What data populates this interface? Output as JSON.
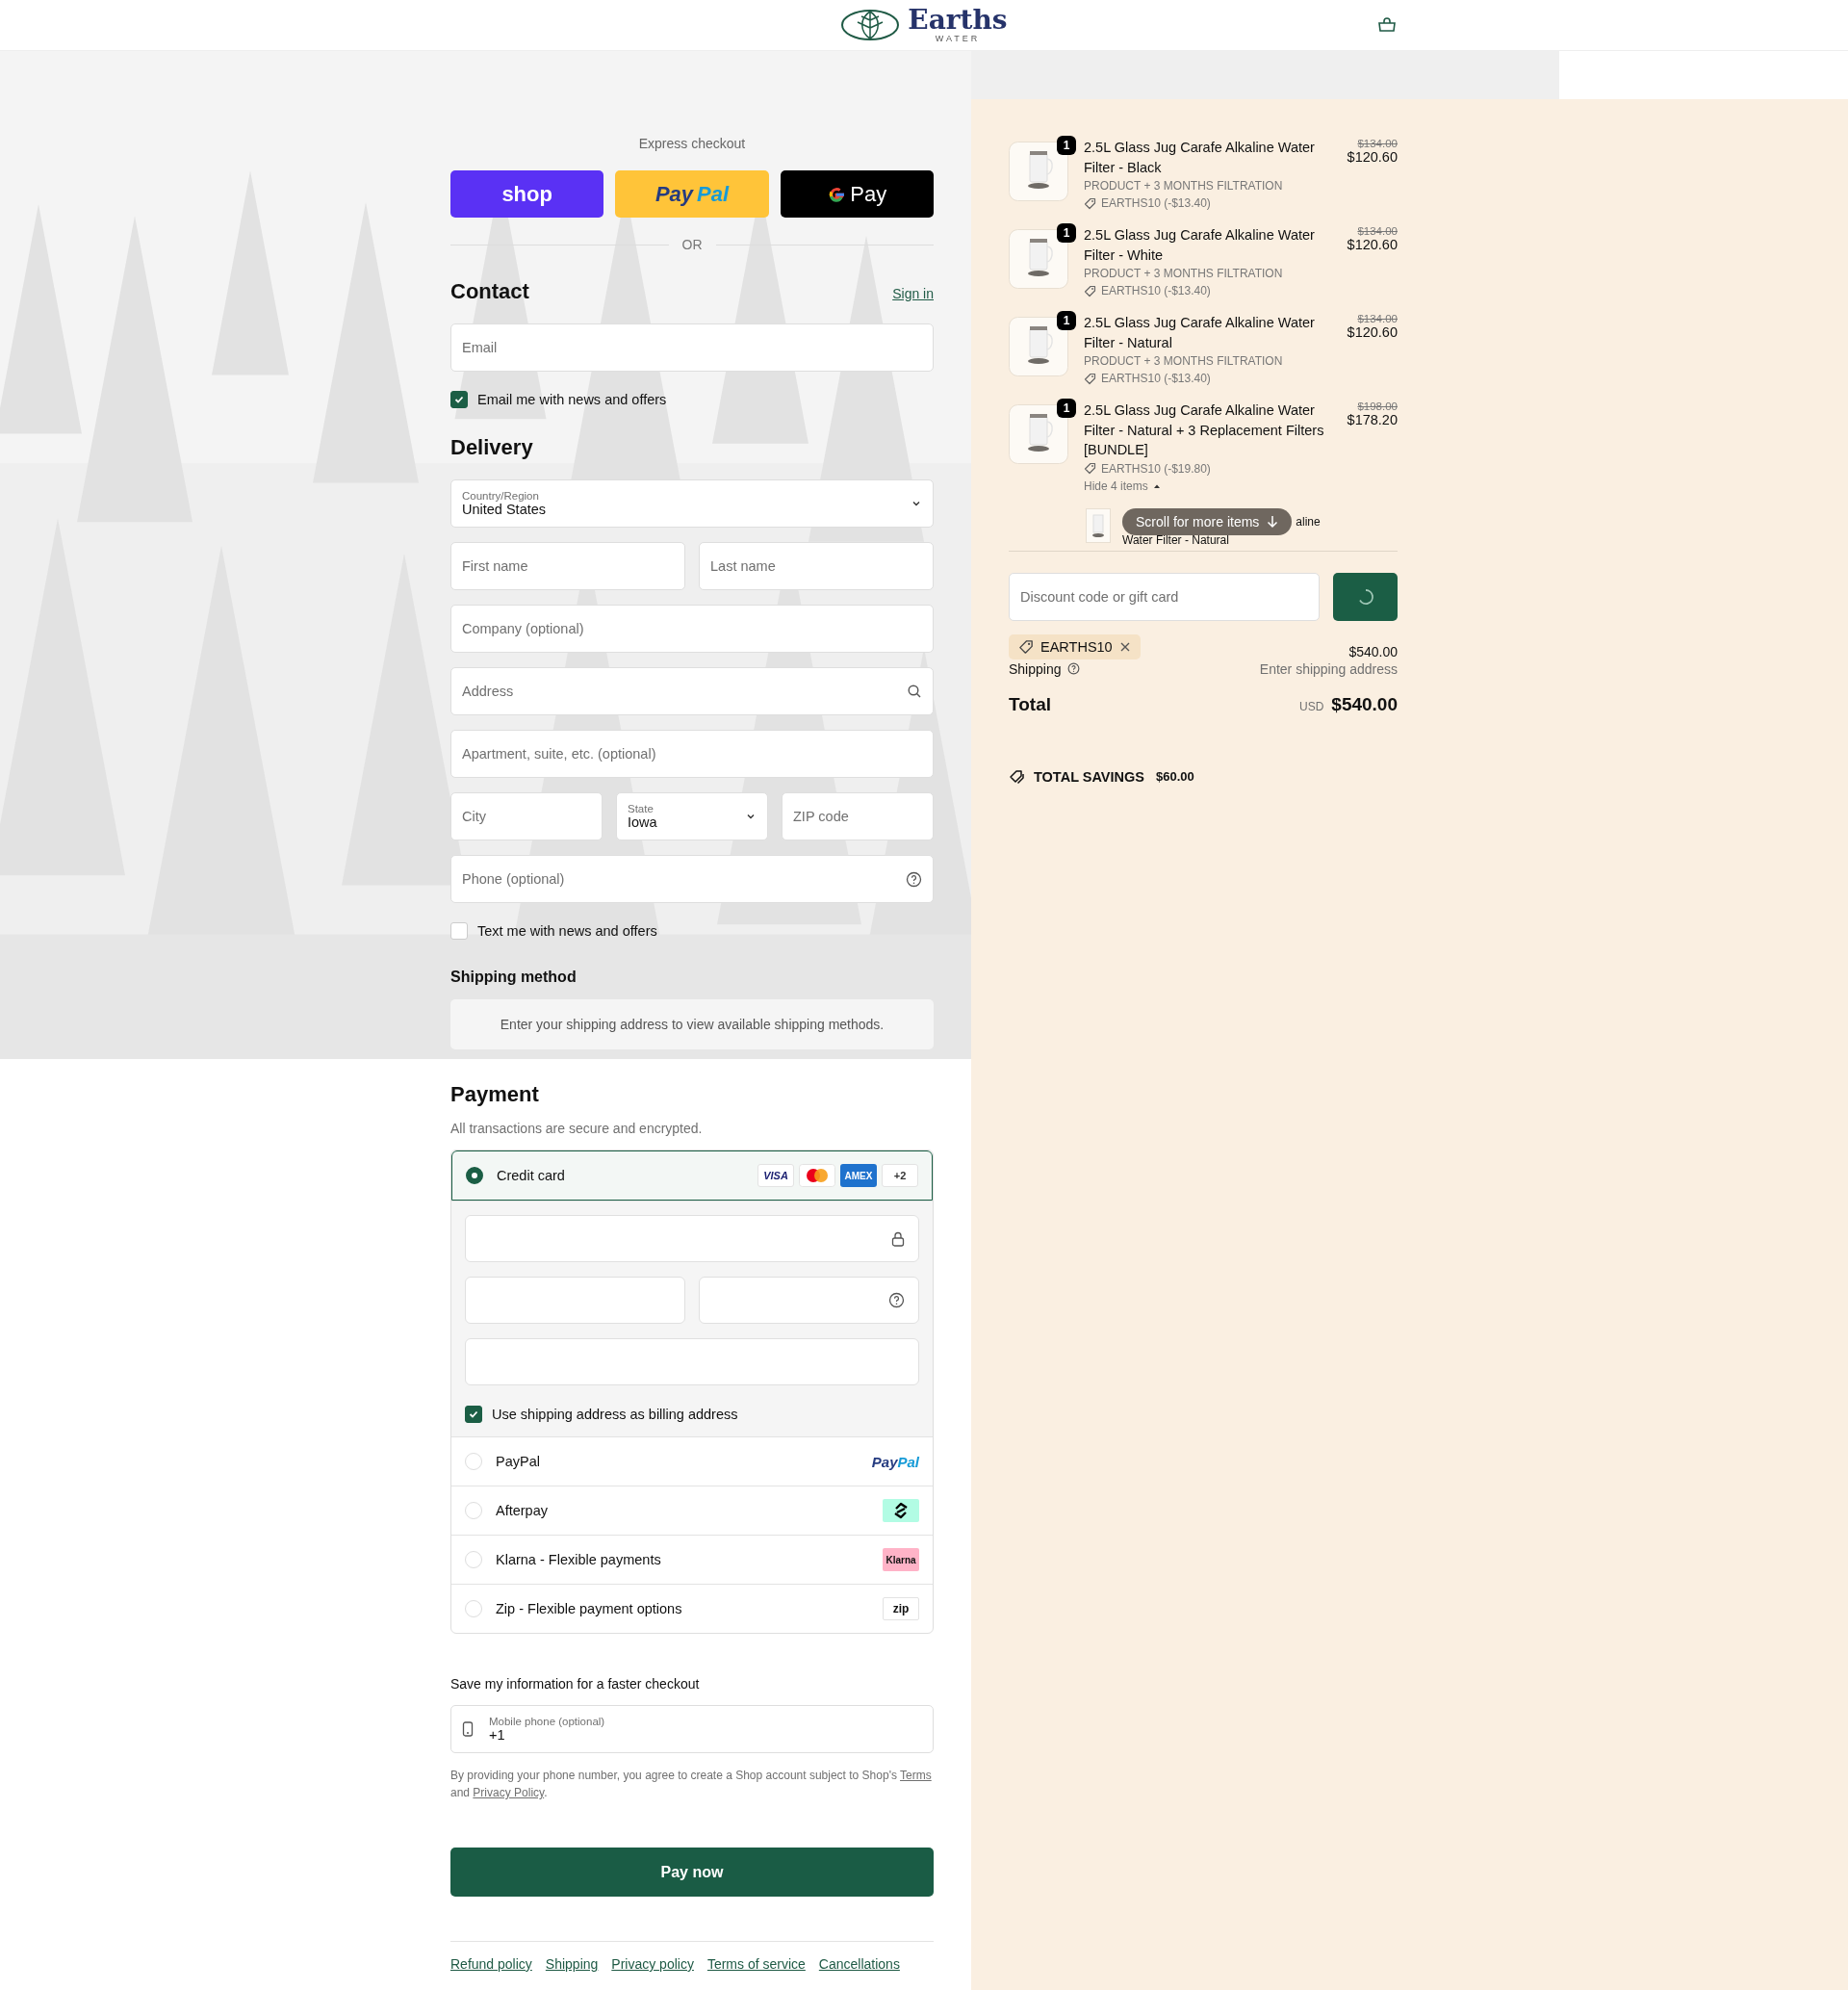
{
  "header": {
    "brand": "Earths",
    "brand_sub": "WATER"
  },
  "express": {
    "title": "Express checkout",
    "divider": "OR",
    "buttons": [
      {
        "kind": "shop",
        "label": "shop"
      },
      {
        "kind": "paypal",
        "label_parts": [
          "Pay",
          "Pal"
        ]
      },
      {
        "kind": "gpay",
        "label": "Pay"
      }
    ]
  },
  "contact": {
    "title": "Contact",
    "sign_in": "Sign in",
    "email": {
      "placeholder": "Email"
    },
    "newsletter": {
      "label": "Email me with news and offers",
      "checked": true
    }
  },
  "delivery": {
    "title": "Delivery",
    "rows": [
      [
        {
          "kind": "select",
          "label": "Country/Region",
          "value": "United States"
        }
      ],
      [
        {
          "kind": "input",
          "placeholder": "First name"
        },
        {
          "kind": "input",
          "placeholder": "Last name"
        }
      ],
      [
        {
          "kind": "input",
          "placeholder": "Company (optional)"
        }
      ],
      [
        {
          "kind": "search",
          "placeholder": "Address"
        }
      ],
      [
        {
          "kind": "input",
          "placeholder": "Apartment, suite, etc. (optional)"
        }
      ],
      [
        {
          "kind": "input",
          "placeholder": "City"
        },
        {
          "kind": "select",
          "label": "State",
          "value": "Iowa"
        },
        {
          "kind": "input",
          "placeholder": "ZIP code"
        }
      ],
      [
        {
          "kind": "help",
          "placeholder": "Phone (optional)"
        }
      ]
    ],
    "sms": {
      "label": "Text me with news and offers",
      "checked": false
    }
  },
  "shipping_method": {
    "title": "Shipping method",
    "notice": "Enter your shipping address to view available shipping methods."
  },
  "payment": {
    "title": "Payment",
    "subtitle": "All transactions are secure and encrypted.",
    "billing": {
      "label": "Use shipping address as billing address",
      "checked": true
    },
    "methods": [
      {
        "kind": "card",
        "label": "Credit card",
        "selected": true,
        "badges": [
          {
            "kind": "visa",
            "text": "VISA"
          },
          {
            "kind": "mastercard"
          },
          {
            "kind": "amex",
            "text": "AMEX"
          },
          {
            "kind": "more",
            "text": "+2"
          }
        ]
      },
      {
        "kind": "paypal",
        "label": "PayPal",
        "selected": false,
        "logo_parts": [
          "Pay",
          "Pal"
        ]
      },
      {
        "kind": "afterpay",
        "label": "Afterpay",
        "selected": false
      },
      {
        "kind": "klarna",
        "label": "Klarna - Flexible payments",
        "selected": false,
        "logo": "Klarna"
      },
      {
        "kind": "zip",
        "label": "Zip - Flexible payment options",
        "selected": false,
        "logo": "zip"
      }
    ]
  },
  "save": {
    "title": "Save my information for a faster checkout",
    "phone": {
      "label": "Mobile phone (optional)",
      "value": "+1"
    },
    "legal": {
      "before": "By providing your phone number, you agree to create a Shop account subject to Shop's",
      "link1": "Terms",
      "middle": "and",
      "link2": "Privacy Policy",
      "after": "."
    }
  },
  "pay_button": "Pay now",
  "footer_links": [
    "Refund policy",
    "Shipping",
    "Privacy policy",
    "Terms of service",
    "Cancellations"
  ],
  "summary": {
    "items": [
      {
        "quantity": "1",
        "name": "2.5L Glass Jug Carafe Alkaline Water Filter - Black",
        "variant": "PRODUCT + 3 MONTHS FILTRATION",
        "discount": "EARTHS10 (-$13.40)",
        "original_price": "$134.00",
        "price": "$120.60"
      },
      {
        "quantity": "1",
        "name": "2.5L Glass Jug Carafe Alkaline Water Filter - White",
        "variant": "PRODUCT + 3 MONTHS FILTRATION",
        "discount": "EARTHS10 (-$13.40)",
        "original_price": "$134.00",
        "price": "$120.60"
      },
      {
        "quantity": "1",
        "name": "2.5L Glass Jug Carafe Alkaline Water Filter - Natural",
        "variant": "PRODUCT + 3 MONTHS FILTRATION",
        "discount": "EARTHS10 (-$13.40)",
        "original_price": "$134.00",
        "price": "$120.60"
      },
      {
        "quantity": "1",
        "name": "2.5L Glass Jug Carafe Alkaline Water Filter - Natural + 3 Replacement Filters [BUNDLE]",
        "discount": "EARTHS10 (-$19.80)",
        "original_price": "$198.00",
        "price": "$178.20",
        "toggle": "Hide 4 items",
        "sub_item": {
          "name_end": "aline",
          "name_line2": "Water Filter - Natural"
        }
      }
    ],
    "scroll_hint": "Scroll for more items",
    "discount_field": {
      "placeholder": "Discount code or gift card"
    },
    "applied_code": "EARTHS10",
    "subtotal": "$540.00",
    "shipping_label": "Shipping",
    "shipping_value": "Enter shipping address",
    "total_label": "Total",
    "currency": "USD",
    "total": "$540.00",
    "savings_label": "TOTAL SAVINGS",
    "savings": "$60.00"
  }
}
